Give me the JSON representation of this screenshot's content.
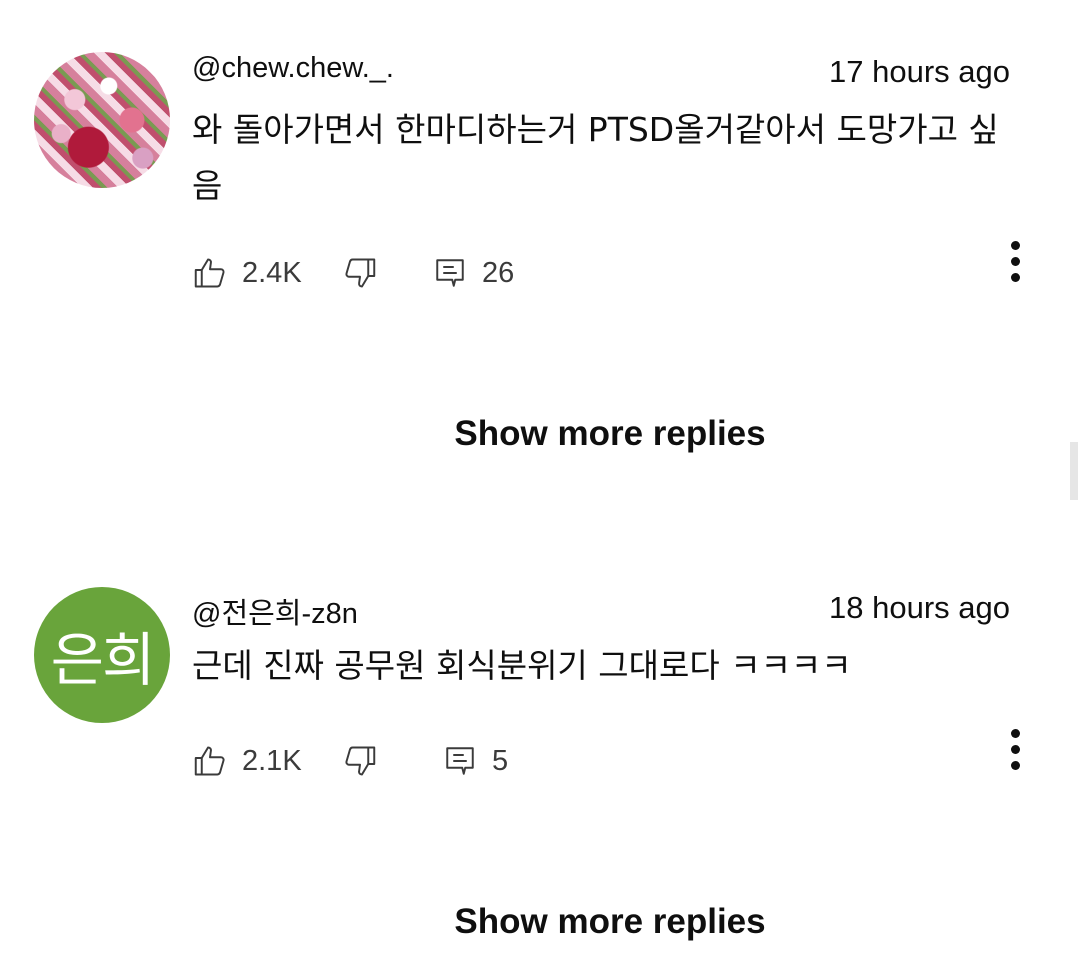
{
  "comments": [
    {
      "username": "@chew.chew._.",
      "time": "17 hours ago",
      "text": "와 돌아가면서 한마디하는거 PTSD올거같아서 도망가고 싶음",
      "likes": "2.4K",
      "replies": "26",
      "show_more": "Show more replies",
      "avatar_type": "photo"
    },
    {
      "username": "@전은희-z8n",
      "time": "18 hours ago",
      "text": "근데 진짜 공무원 회식분위기 그대로다 ㅋㅋㅋㅋ",
      "likes": "2.1K",
      "replies": "5",
      "show_more": "Show more replies",
      "avatar_type": "letter",
      "avatar_text": "은희",
      "avatar_color": "#69a43b"
    }
  ],
  "icons": {
    "like": "thumbs-up-icon",
    "dislike": "thumbs-down-icon",
    "reply": "comment-icon",
    "menu": "more-vertical-icon"
  }
}
